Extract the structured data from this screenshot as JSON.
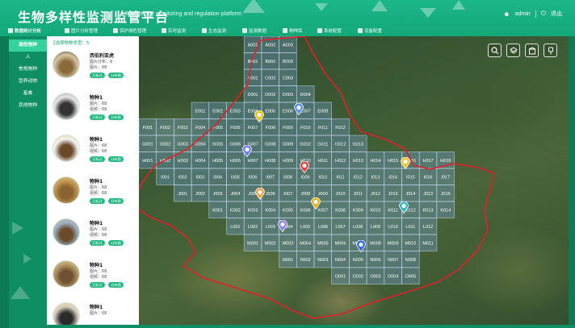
{
  "header": {
    "title": "生物多样性监测监管平台",
    "subtitle": "Biodiversity monitoring and regulation platform",
    "user": "admin",
    "logout": "退出"
  },
  "nav": [
    {
      "label": "数据统计分析",
      "active": true,
      "icon": "chart-icon"
    },
    {
      "label": "图片分析管理",
      "icon": "image-icon"
    },
    {
      "label": "保护濒危管理",
      "icon": "shield-icon"
    },
    {
      "label": "实时监测",
      "icon": "monitor-icon"
    },
    {
      "label": "生态监测",
      "icon": "leaf-icon"
    },
    {
      "label": "监测数据",
      "icon": "data-icon"
    },
    {
      "label": "物种库",
      "icon": "book-icon"
    },
    {
      "label": "系统配置",
      "icon": "gear-icon"
    },
    {
      "label": "设备配置",
      "icon": "device-icon"
    }
  ],
  "categories": [
    {
      "label": "濒危物种",
      "active": true
    },
    {
      "label": "人"
    },
    {
      "label": "常规物种"
    },
    {
      "label": "营养动物"
    },
    {
      "label": "畜禽"
    },
    {
      "label": "其他物种"
    }
  ],
  "list": {
    "header": "【选择物种类型：5",
    "items": [
      {
        "name": "西伯利亚虎",
        "l1": "图片分布：6",
        "l2": "图片：68",
        "btn1": "已标注",
        "btn2": "分布图"
      },
      {
        "name": "物种1",
        "l1": "图片：68",
        "l2": "视频：68",
        "btn1": "已标注",
        "btn2": "分布图"
      },
      {
        "name": "物种1",
        "l1": "图片：68",
        "l2": "视频：68",
        "btn1": "已标注",
        "btn2": "分布图"
      },
      {
        "name": "物种1",
        "l1": "图片：68",
        "l2": "视频：68",
        "btn1": "已标注",
        "btn2": "分布图"
      },
      {
        "name": "物种1",
        "l1": "图片：68",
        "l2": "视频：68",
        "btn1": "已标注",
        "btn2": "分布图"
      },
      {
        "name": "物种1",
        "l1": "图片：68",
        "l2": "视频：68",
        "btn1": "已标注",
        "btn2": "分布图"
      },
      {
        "name": "物种1",
        "l1": "图片：68",
        "l2": "",
        "btn1": "",
        "btn2": ""
      }
    ]
  },
  "map": {
    "tools": [
      "search-icon",
      "layers-icon",
      "building-icon",
      "tree-icon"
    ],
    "grid_rows": [
      {
        "row": "A",
        "cols": [
          "A001",
          "A002",
          "A003"
        ]
      },
      {
        "row": "B",
        "cols": [
          "B001",
          "B002",
          "B003"
        ]
      },
      {
        "row": "C",
        "cols": [
          "C001",
          "C002",
          "C003"
        ]
      },
      {
        "row": "D",
        "cols": [
          "D001",
          "D002",
          "D003",
          "D004"
        ]
      },
      {
        "row": "E",
        "cols": [
          "E001",
          "E002",
          "E003",
          "E004",
          "E005",
          "E006",
          "E007",
          "E008"
        ]
      },
      {
        "row": "F",
        "cols": [
          "F001",
          "F002",
          "F003",
          "F004",
          "F005",
          "F006",
          "F007",
          "F008",
          "F009",
          "F010",
          "F011",
          "F012"
        ]
      },
      {
        "row": "G",
        "cols": [
          "G001",
          "G002",
          "G003",
          "G004",
          "G005",
          "G006",
          "G007",
          "G008",
          "G009",
          "G010",
          "G011",
          "G012",
          "G013"
        ]
      },
      {
        "row": "H",
        "cols": [
          "H001",
          "H002",
          "H003",
          "H004",
          "H005",
          "H006",
          "H007",
          "H008",
          "H009",
          "H010",
          "H011",
          "H012",
          "H013",
          "H014",
          "H015",
          "H016",
          "H017",
          "H018"
        ]
      },
      {
        "row": "I",
        "cols": [
          "I001",
          "I002",
          "I003",
          "I004",
          "I005",
          "I006",
          "I007",
          "I008",
          "I009",
          "I010",
          "I011",
          "I012",
          "I013",
          "I014",
          "I015",
          "I016",
          "I017"
        ]
      },
      {
        "row": "J",
        "cols": [
          "J001",
          "J002",
          "J003",
          "J004",
          "J005",
          "J006",
          "J007",
          "J008",
          "J009",
          "J010",
          "J011",
          "J012",
          "J013",
          "J014",
          "J013",
          "J016"
        ]
      },
      {
        "row": "K",
        "cols": [
          "K001",
          "K002",
          "K003",
          "K004",
          "K005",
          "K006",
          "K007",
          "K008",
          "K009",
          "K010",
          "K011",
          "K012",
          "K013",
          "K014"
        ]
      },
      {
        "row": "L",
        "cols": [
          "L001",
          "L002",
          "L003",
          "L004",
          "L005",
          "L006",
          "L007",
          "L008",
          "L009",
          "L010",
          "L011",
          "L012"
        ]
      },
      {
        "row": "M",
        "cols": [
          "M001",
          "M002",
          "M003",
          "M004",
          "M005",
          "M006",
          "M007",
          "M008",
          "M009",
          "M010",
          "M011"
        ]
      },
      {
        "row": "N",
        "cols": [
          "N001",
          "N002",
          "N003",
          "N004",
          "N005",
          "N006",
          "N007",
          "N008"
        ]
      },
      {
        "row": "O",
        "cols": [
          "O001",
          "O002",
          "O003",
          "O004",
          "O005"
        ]
      }
    ],
    "pins": [
      {
        "color": "#f2c21b",
        "icon": "pin-icon"
      },
      {
        "color": "#5b8ef0",
        "icon": "pin-icon"
      },
      {
        "color": "#6d7cf3",
        "icon": "pin-icon"
      },
      {
        "color": "#e8403f",
        "icon": "pin-icon"
      },
      {
        "color": "#f2a23a",
        "icon": "pin-icon"
      },
      {
        "color": "#e6b31c",
        "icon": "pin-icon"
      },
      {
        "color": "#2fb6c4",
        "icon": "pin-icon"
      },
      {
        "color": "#8f7df0",
        "icon": "pin-icon"
      },
      {
        "color": "#2d6be0",
        "icon": "pin-icon"
      },
      {
        "color": "#f0c22a",
        "icon": "pin-icon"
      }
    ]
  },
  "colors": {
    "brand": "#1bb787",
    "boundary": "#e21f2a"
  }
}
